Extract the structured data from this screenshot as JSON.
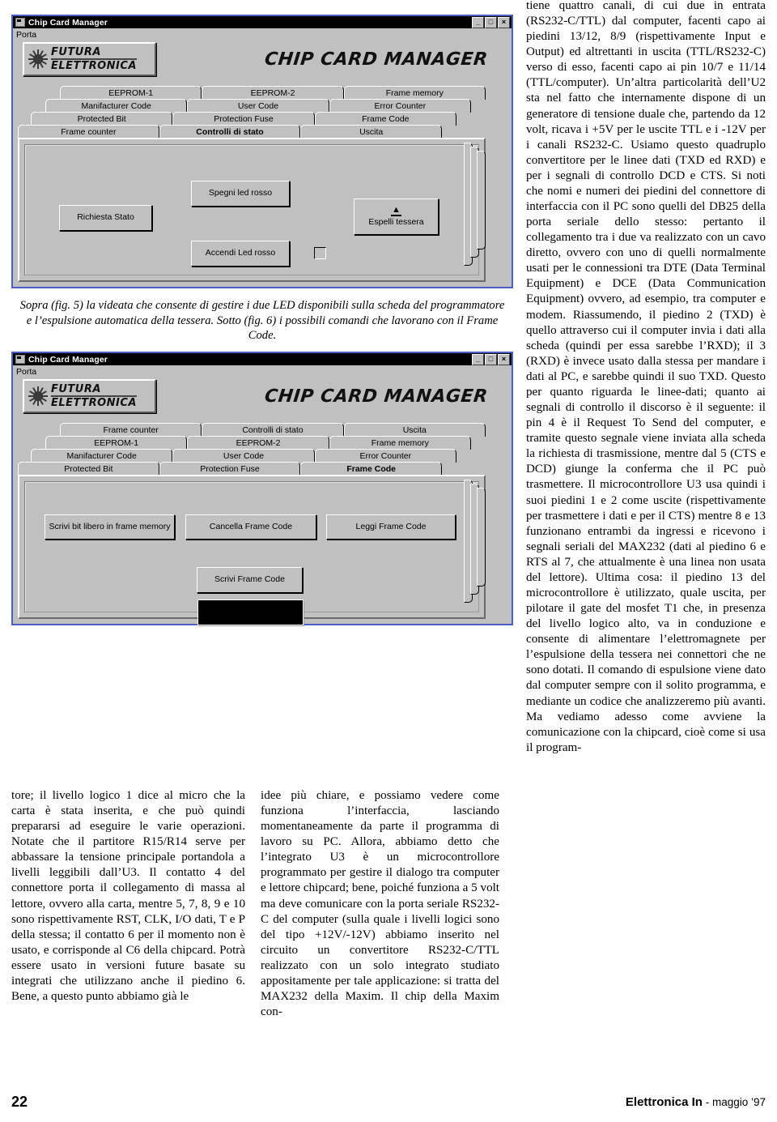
{
  "figures": [
    {
      "id": "fig5",
      "window": {
        "title": "Chip Card Manager",
        "icon": "app-icon",
        "buttons": {
          "minimize": "_",
          "restore": "□",
          "close": "×"
        },
        "menu": [
          "Porta"
        ],
        "brand": {
          "line1": "FUTURA",
          "line2": "ELETTRONICA"
        },
        "app_title": "CHIP CARD MANAGER"
      },
      "tab_rows": [
        [
          "EEPROM-1",
          "EEPROM-2",
          "Frame memory"
        ],
        [
          "Manifacturer Code",
          "User Code",
          "Error Counter"
        ],
        [
          "Protected Bit",
          "Protection Fuse",
          "Frame Code"
        ],
        [
          "Frame counter",
          "Controlli di stato",
          "Uscita"
        ]
      ],
      "selected_tab": "Controlli di stato",
      "controls": [
        {
          "name": "richiesta-stato-button",
          "label": "Richiesta Stato"
        },
        {
          "name": "spegni-led-rosso-button",
          "label": "Spegni led rosso"
        },
        {
          "name": "accendi-led-rosso-button",
          "label": "Accendi Led  rosso"
        },
        {
          "name": "espelli-tessera-button",
          "label": "Espelli tessera",
          "icon": "eject-icon"
        },
        {
          "name": "led-checkbox",
          "label": "",
          "checked": false
        }
      ]
    },
    {
      "id": "fig6",
      "window": {
        "title": "Chip Card Manager",
        "icon": "app-icon",
        "buttons": {
          "minimize": "_",
          "restore": "□",
          "close": "×"
        },
        "menu": [
          "Porta"
        ],
        "brand": {
          "line1": "FUTURA",
          "line2": "ELETTRONICA"
        },
        "app_title": "CHIP CARD MANAGER"
      },
      "tab_rows": [
        [
          "Frame counter",
          "Controlli di stato",
          "Uscita"
        ],
        [
          "EEPROM-1",
          "EEPROM-2",
          "Frame memory"
        ],
        [
          "Manifacturer Code",
          "User Code",
          "Error Counter"
        ],
        [
          "Protected Bit",
          "Protection Fuse",
          "Frame Code"
        ]
      ],
      "selected_tab": "Frame Code",
      "controls": [
        {
          "name": "scrivi-bit-libero-button",
          "label": "Scrivi bit libero in frame memory"
        },
        {
          "name": "cancella-frame-code-button",
          "label": "Cancella Frame Code"
        },
        {
          "name": "leggi-frame-code-button",
          "label": "Leggi Frame Code"
        },
        {
          "name": "scrivi-frame-code-button",
          "label": "Scrivi Frame Code"
        },
        {
          "name": "frame-code-display",
          "label": ""
        }
      ]
    }
  ],
  "caption": "Sopra (fig. 5) la videata che consente di gestire i due LED disponibili sulla scheda del programmatore e l’espulsione automatica della tessera. Sotto (fig. 6) i possibili comandi che lavorano con il Frame Code.",
  "columns": {
    "col1": "tore; il livello logico 1 dice al micro che la carta è stata inserita, e che può quindi prepararsi ad eseguire le varie operazioni. Notate che il partitore R15/R14 serve per abbassare la tensione principale portandola a livelli leggibili dall’U3. Il contatto 4 del connettore porta il collegamento di massa al lettore, ovvero alla carta, mentre 5, 7, 8, 9 e 10 sono rispettivamente RST, CLK, I/O dati, T e P della stessa; il contatto 6 per il momento non è usato, e corrisponde al C6 della chipcard. Potrà essere usato in versioni future basate su integrati che utilizzano anche il piedino 6. Bene, a questo punto abbiamo già le",
    "col2": "idee più chiare, e possiamo vedere come funziona l’interfaccia, lasciando momentaneamente da parte il programma di lavoro su PC. Allora, abbiamo detto che l’integrato U3 è un microcontrollore programmato per gestire il dialogo tra computer e lettore chipcard; bene, poiché funziona a 5 volt ma deve comunicare con la porta seriale RS232-C del computer (sulla quale i livelli logici sono del tipo +12V/-12V) abbiamo inserito nel circuito un convertitore RS232-C/TTL realizzato con un solo integrato studiato appositamente per tale applicazione: si tratta del MAX232 della Maxim. Il chip della Maxim con-",
    "col3": "tiene quattro canali, di cui due in entrata (RS232-C/TTL) dal computer, facenti capo ai piedini 13/12, 8/9 (rispettivamente Input e Output) ed altrettanti in uscita (TTL/RS232-C) verso di esso, facenti capo ai pin 10/7 e 11/14 (TTL/computer). Un’altra particolarità dell’U2 sta nel fatto che internamente dispone di un generatore di tensione duale che, partendo da 12 volt, ricava i +5V per le uscite TTL e i -12V per i canali RS232-C. Usiamo questo quadruplo convertitore per le linee dati (TXD ed RXD) e per i segnali di controllo DCD e CTS. Si noti che nomi e numeri dei piedini del connettore di interfaccia con il PC sono quelli del DB25 della porta seriale dello stesso: pertanto il collegamento tra i due va realizzato con un cavo diretto, ovvero con uno di quelli normalmente usati per le connessioni tra DTE (Data Terminal Equipment) e DCE (Data Communication Equipment) ovvero, ad esempio, tra computer e modem. Riassumendo, il piedino 2 (TXD) è quello attraverso cui il computer invia i dati alla scheda (quindi per essa sarebbe l’RXD); il 3 (RXD) è invece usato dalla stessa per mandare i dati al PC, e sarebbe quindi il suo TXD. Questo per quanto riguarda le linee-dati; quanto ai segnali di controllo il discorso è il seguente: il pin 4 è il Request To Send del computer,  e tramite questo segnale viene inviata alla scheda la richiesta di trasmissione, mentre dal 5 (CTS e DCD) giunge la conferma che il PC può trasmettere. Il microcontrollore U3 usa quindi i suoi piedini 1 e 2 come uscite (rispettivamente per trasmettere i dati e per il CTS) mentre 8 e 13 funzionano entrambi da ingressi e ricevono i segnali seriali del MAX232 (dati al piedino 6 e RTS al 7, che attualmente è una linea non usata del lettore). Ultima cosa: il piedino 13 del microcontrollore è utilizzato, quale uscita, per pilotare il gate del mosfet T1 che, in presenza del livello logico alto, va in conduzione e consente di alimentare l’elettromagnete per l’espulsione della tessera nei connettori che ne sono dotati. Il comando di espulsione viene dato dal computer sempre con il solito programma, e mediante un codice che analizzeremo più avanti. Ma vediamo adesso come avviene la comunicazione con la chipcard, cioè come si usa il program-"
  },
  "footer": {
    "page_number": "22",
    "magazine": "Elettronica In",
    "issue": " - maggio ’97"
  }
}
